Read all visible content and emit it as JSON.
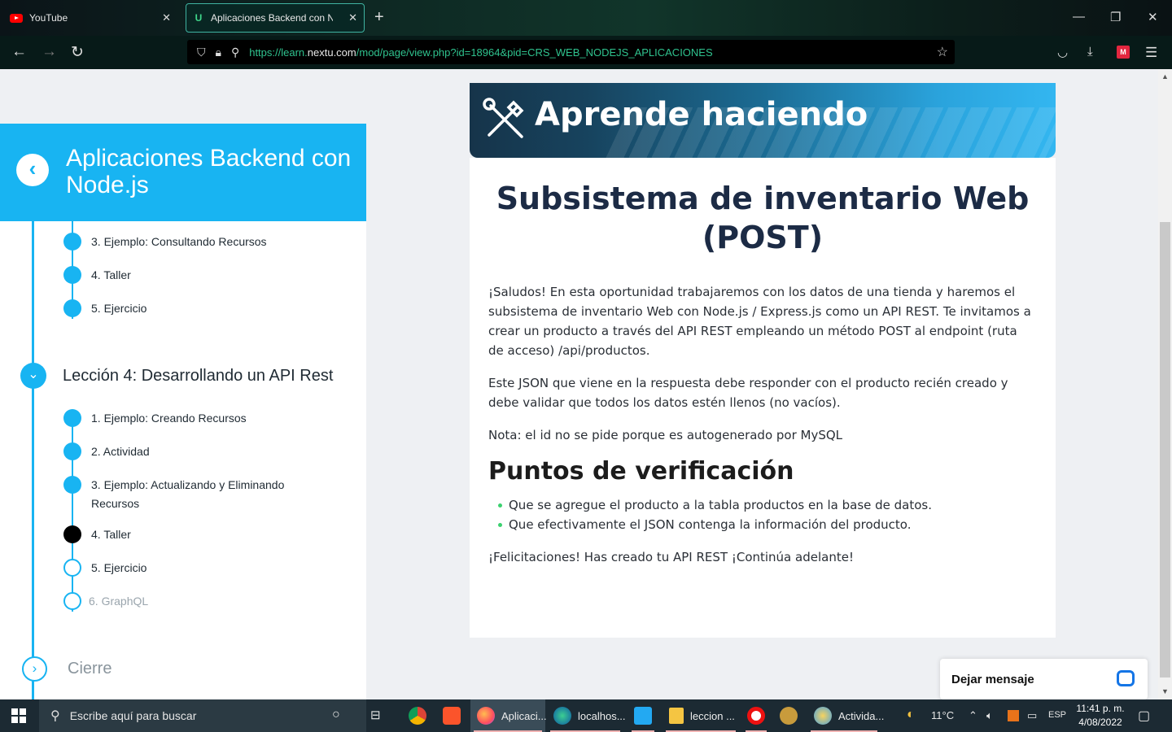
{
  "browser": {
    "tabs": [
      {
        "title": "YouTube",
        "active": false
      },
      {
        "title": "Aplicaciones Backend con Node.js",
        "active": true
      }
    ],
    "url_prefix": "https://learn.",
    "url_host": "nextu.com",
    "url_path": "/mod/page/view.php?id=18964&pid=CRS_WEB_NODEJS_APLICACIONES"
  },
  "sidebar": {
    "course_title": "Aplicaciones Backend con Node.js",
    "prev_lesson_items": [
      {
        "label": "3. Ejemplo: Consultando Recursos",
        "state": "done"
      },
      {
        "label": "4. Taller",
        "state": "done"
      },
      {
        "label": "5. Ejercicio",
        "state": "done"
      }
    ],
    "lesson4_label": "Lección 4: Desarrollando un API Rest",
    "lesson4_items": [
      {
        "label": "1. Ejemplo: Creando Recursos",
        "state": "done"
      },
      {
        "label": "2. Actividad",
        "state": "done"
      },
      {
        "label": "3. Ejemplo: Actualizando y Eliminando Recursos",
        "state": "done"
      },
      {
        "label": "4. Taller",
        "state": "current"
      },
      {
        "label": "5. Ejercicio",
        "state": "pending"
      },
      {
        "label": "6. GraphQL",
        "state": "locked"
      }
    ],
    "cierre_label": "Cierre"
  },
  "content": {
    "banner_title": "Aprende haciendo",
    "title": "Subsistema de inventario Web (POST)",
    "paragraphs": [
      "¡Saludos! En esta oportunidad trabajaremos con los datos de una tienda y haremos el subsistema de inventario Web con Node.js / Express.js como un API REST. Te invitamos a crear un producto a través del API REST empleando un método POST al endpoint (ruta de acceso) /api/productos.",
      "Este JSON que viene en la respuesta debe responder con el producto recién creado y debe validar que todos los datos estén llenos (no vacíos).",
      "Nota: el id no se pide porque es autogenerado por MySQL"
    ],
    "checkpoints_title": "Puntos de verificación",
    "checkpoints": [
      "Que se agregue el producto a la tabla productos en la base de datos.",
      "Que efectivamente el JSON contenga la información del producto."
    ],
    "closing": "¡Felicitaciones! Has creado tu API REST ¡Continúa adelante!"
  },
  "chat": {
    "label": "Dejar mensaje"
  },
  "taskbar": {
    "search_placeholder": "Escribe aquí para buscar",
    "apps": [
      {
        "label": "Aplicaci...",
        "icon": "firefox-icon"
      },
      {
        "label": "localhos...",
        "icon": "edge-icon"
      },
      {
        "label": "leccion ...",
        "icon": "folder-icon"
      },
      {
        "label": "Activida...",
        "icon": "paint-icon"
      }
    ],
    "weather": "11°C",
    "lang": "ESP",
    "time": "11:41 p. m.",
    "date": "4/08/2022"
  },
  "colors": {
    "accent": "#18b4f2",
    "heading": "#1c2b45",
    "bullet": "#3bd16f"
  }
}
